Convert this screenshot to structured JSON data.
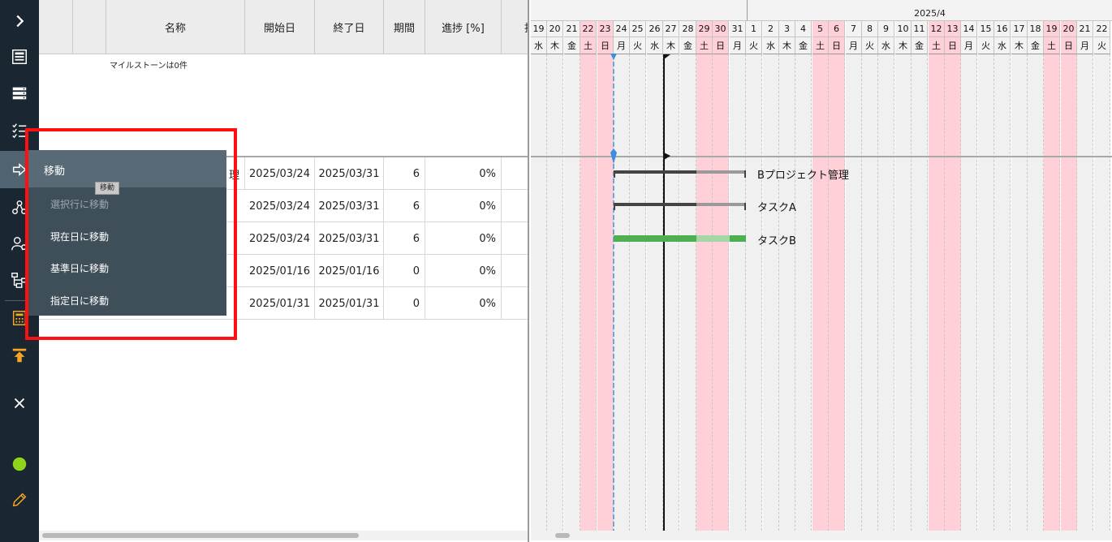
{
  "sidebar": {
    "icons": [
      "chevron-right-icon",
      "layout-icon",
      "server-icon",
      "checklist-icon",
      "arrow-right-icon",
      "network-icon",
      "users-icon",
      "hierarchy-icon",
      "calculator-icon",
      "upload-icon",
      "close-icon",
      "status-dot-icon",
      "pencil-icon"
    ],
    "status_color": "#8ed41a",
    "accent_color": "#f5a623"
  },
  "grid": {
    "columns": {
      "name": "名称",
      "start": "開始日",
      "end": "終了日",
      "duration": "期間",
      "progress": "進捗 [%]",
      "extra": "担"
    },
    "milestone_note": "マイルストーンは0件",
    "rows": [
      {
        "name_tail": "理",
        "start": "2025/03/24",
        "end": "2025/03/31",
        "duration": "6",
        "progress": "0%"
      },
      {
        "start": "2025/03/24",
        "end": "2025/03/31",
        "duration": "6",
        "progress": "0%"
      },
      {
        "start": "2025/03/24",
        "end": "2025/03/31",
        "duration": "6",
        "progress": "0%"
      },
      {
        "start": "2025/01/16",
        "end": "2025/01/16",
        "duration": "0",
        "progress": "0%"
      },
      {
        "start": "2025/01/31",
        "end": "2025/01/31",
        "duration": "0",
        "progress": "0%"
      }
    ]
  },
  "gantt": {
    "month_label": "2025/4",
    "days": [
      "19",
      "20",
      "21",
      "22",
      "23",
      "24",
      "25",
      "26",
      "27",
      "28",
      "29",
      "30",
      "31",
      "1",
      "2",
      "3",
      "4",
      "5",
      "6",
      "7",
      "8",
      "9",
      "10",
      "11",
      "12",
      "13",
      "14",
      "15",
      "16",
      "17",
      "18",
      "19",
      "20",
      "21",
      "22"
    ],
    "weekdays": [
      "水",
      "木",
      "金",
      "土",
      "日",
      "月",
      "火",
      "水",
      "木",
      "金",
      "土",
      "日",
      "月",
      "火",
      "水",
      "木",
      "金",
      "土",
      "日",
      "月",
      "火",
      "水",
      "木",
      "金",
      "土",
      "日",
      "月",
      "火",
      "水",
      "木",
      "金",
      "土",
      "日",
      "月",
      "火"
    ],
    "weekend_indices": [
      3,
      4,
      10,
      11,
      17,
      18,
      24,
      25,
      31,
      32
    ],
    "bars": [
      {
        "label": "Bプロジェクト管理",
        "type": "summary"
      },
      {
        "label": "タスクA",
        "type": "summary"
      },
      {
        "label": "タスクB",
        "type": "task",
        "color": "#4caf50"
      }
    ]
  },
  "menu": {
    "title": "移動",
    "tooltip": "移動",
    "items": [
      {
        "label": "選択行に移動",
        "enabled": false
      },
      {
        "label": "現在日に移動",
        "enabled": true
      },
      {
        "label": "基準日に移動",
        "enabled": true
      },
      {
        "label": "指定日に移動",
        "enabled": true
      }
    ]
  }
}
